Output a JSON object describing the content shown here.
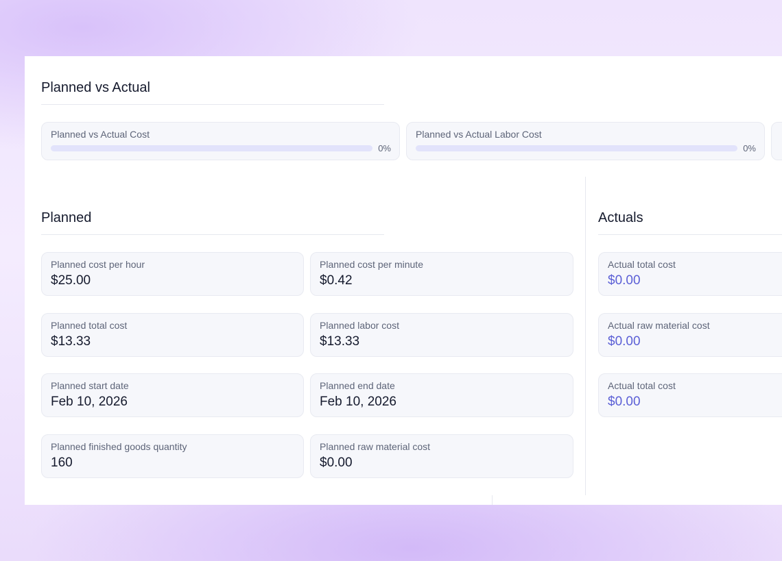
{
  "summary": {
    "title": "Planned vs Actual",
    "metrics": [
      {
        "label": "Planned vs Actual Cost",
        "percent_text": "0%",
        "progress": 0
      },
      {
        "label": "Planned vs Actual Labor Cost",
        "percent_text": "0%",
        "progress": 0
      }
    ]
  },
  "planned": {
    "title": "Planned",
    "cards": [
      {
        "label": "Planned cost per hour",
        "value": "$25.00"
      },
      {
        "label": "Planned cost per minute",
        "value": "$0.42"
      },
      {
        "label": "Planned total cost",
        "value": "$13.33"
      },
      {
        "label": "Planned labor cost",
        "value": "$13.33"
      },
      {
        "label": "Planned start date",
        "value": "Feb 10, 2026"
      },
      {
        "label": "Planned end date",
        "value": "Feb 10, 2026"
      },
      {
        "label": "Planned finished goods quantity",
        "value": "160"
      },
      {
        "label": "Planned raw material cost",
        "value": "$0.00"
      }
    ]
  },
  "actuals": {
    "title": "Actuals",
    "cards": [
      {
        "label": "Actual total cost",
        "value": "$0.00"
      },
      {
        "label": "Actual raw material cost",
        "value": "$0.00"
      },
      {
        "label": "Actual total cost",
        "value": "$0.00"
      }
    ]
  },
  "colors": {
    "accent": "#5b5fd6",
    "progress_track": "#e2e3fb"
  }
}
